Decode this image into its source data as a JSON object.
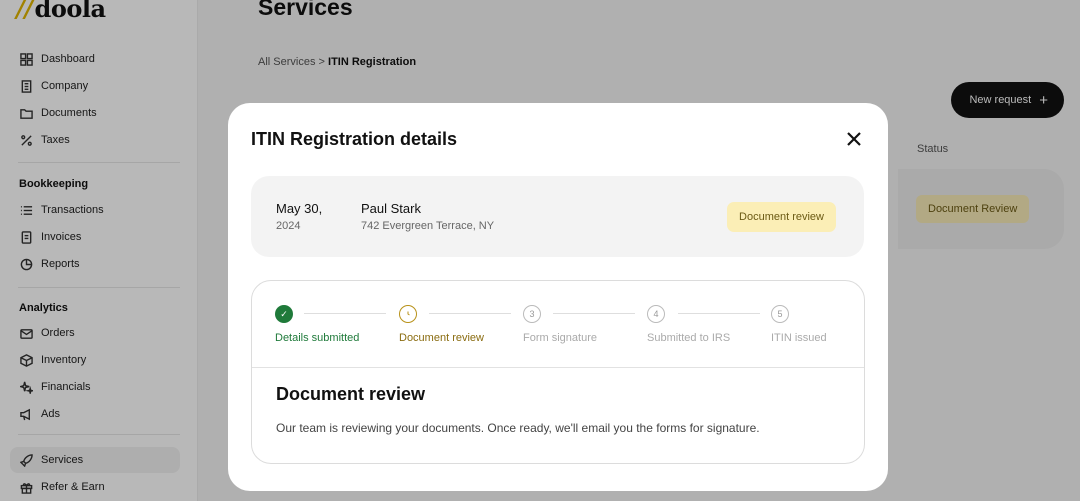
{
  "brand": {
    "logo_mark": "//",
    "logo_text": "doola",
    "accent": "#e0b400"
  },
  "sidebar": {
    "main_items": [
      {
        "label": "Dashboard",
        "icon": "grid-icon"
      },
      {
        "label": "Company",
        "icon": "building-icon"
      },
      {
        "label": "Documents",
        "icon": "folder-icon"
      },
      {
        "label": "Taxes",
        "icon": "percent-icon"
      }
    ],
    "bookkeeping": {
      "title": "Bookkeeping",
      "items": [
        {
          "label": "Transactions",
          "icon": "list-icon"
        },
        {
          "label": "Invoices",
          "icon": "invoice-icon"
        },
        {
          "label": "Reports",
          "icon": "pie-chart-icon"
        }
      ]
    },
    "analytics": {
      "title": "Analytics",
      "items": [
        {
          "label": "Orders",
          "icon": "mail-icon"
        },
        {
          "label": "Inventory",
          "icon": "box-icon"
        },
        {
          "label": "Financials",
          "icon": "sparkle-icon"
        },
        {
          "label": "Ads",
          "icon": "megaphone-icon"
        }
      ]
    },
    "bottom_items": [
      {
        "label": "Services",
        "icon": "rocket-icon",
        "active": true
      },
      {
        "label": "Refer & Earn",
        "icon": "gift-icon"
      }
    ]
  },
  "main": {
    "title": "Services",
    "breadcrumb": {
      "parent": "All Services",
      "separator": ">",
      "current": "ITIN Registration"
    },
    "new_request_label": "New request",
    "table": {
      "status_header": "Status",
      "row_status": "Document Review"
    }
  },
  "modal": {
    "title": "ITIN Registration details",
    "summary": {
      "date": "May 30,",
      "year": "2024",
      "name": "Paul Stark",
      "address": "742 Evergreen Terrace, NY",
      "status": "Document review"
    },
    "steps": [
      {
        "number": "1",
        "label": "Details submitted",
        "state": "done"
      },
      {
        "number": "2",
        "label": "Document review",
        "state": "current"
      },
      {
        "number": "3",
        "label": "Form signature",
        "state": "todo"
      },
      {
        "number": "4",
        "label": "Submitted to IRS",
        "state": "todo"
      },
      {
        "number": "5",
        "label": "ITIN issued",
        "state": "todo"
      }
    ],
    "current_step": {
      "title": "Document review",
      "description": "Our team is reviewing your documents. Once ready, we'll email you the forms for signature."
    }
  },
  "colors": {
    "done": "#1f7a3a",
    "current": "#b8921a",
    "badge_bg": "#fbeeb6"
  }
}
